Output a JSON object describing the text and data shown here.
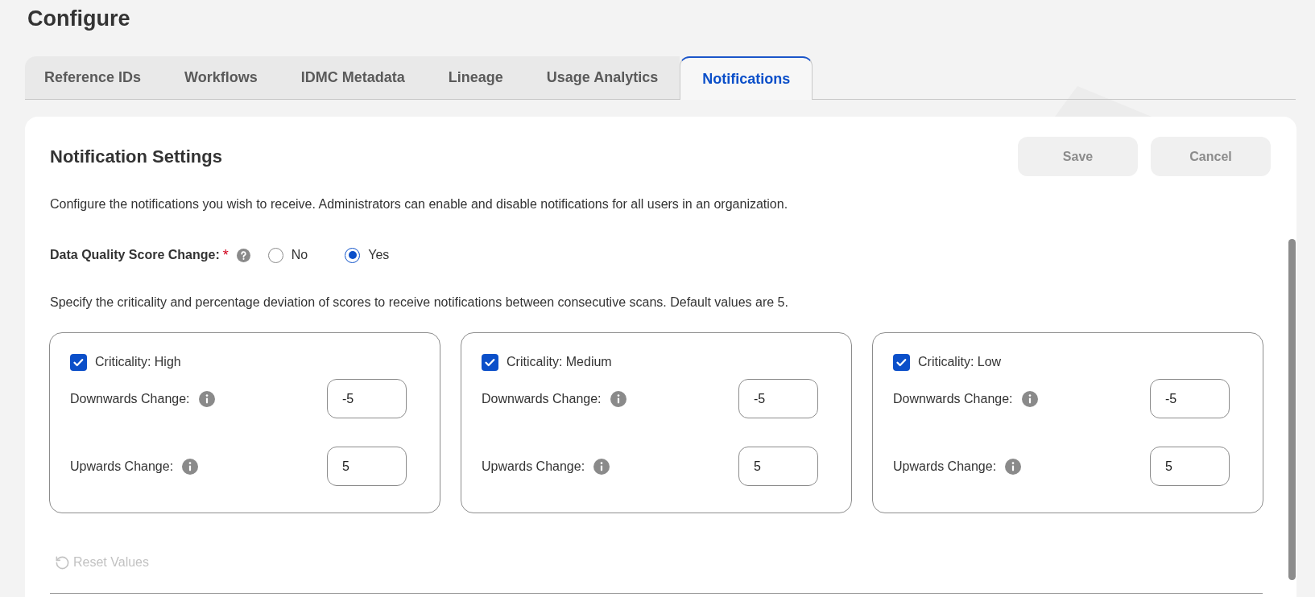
{
  "page": {
    "title": "Configure"
  },
  "tabs": [
    {
      "label": "Reference IDs",
      "selected": false
    },
    {
      "label": "Workflows",
      "selected": false
    },
    {
      "label": "IDMC Metadata",
      "selected": false
    },
    {
      "label": "Lineage",
      "selected": false
    },
    {
      "label": "Usage Analytics",
      "selected": false
    },
    {
      "label": "Notifications",
      "selected": true
    }
  ],
  "panel": {
    "title": "Notification Settings",
    "buttons": [
      {
        "label": "Save",
        "disabled": true
      },
      {
        "label": "Cancel",
        "disabled": true
      }
    ],
    "description": "Configure the notifications you wish to receive. Administrators can enable and disable notifications for all users in an organization.",
    "score_change": {
      "label": "Data Quality Score Change:",
      "required_mark": "*",
      "options": [
        {
          "label": "No",
          "selected": false
        },
        {
          "label": "Yes",
          "selected": true
        }
      ]
    },
    "instructions": "Specify the criticality and percentage deviation of scores to receive notifications between consecutive scans. Default values are 5.",
    "criticality_cards": [
      {
        "label": "Criticality: High",
        "checked": true,
        "fields": [
          {
            "label": "Downwards Change:",
            "value": "-5"
          },
          {
            "label": "Upwards Change:",
            "value": "5"
          }
        ]
      },
      {
        "label": "Criticality: Medium",
        "checked": true,
        "fields": [
          {
            "label": "Downwards Change:",
            "value": "-5"
          },
          {
            "label": "Upwards Change:",
            "value": "5"
          }
        ]
      },
      {
        "label": "Criticality: Low",
        "checked": true,
        "fields": [
          {
            "label": "Downwards Change:",
            "value": "-5"
          },
          {
            "label": "Upwards Change:",
            "value": "5"
          }
        ]
      }
    ],
    "reset_button": {
      "label": "Reset Values",
      "disabled": true
    }
  }
}
